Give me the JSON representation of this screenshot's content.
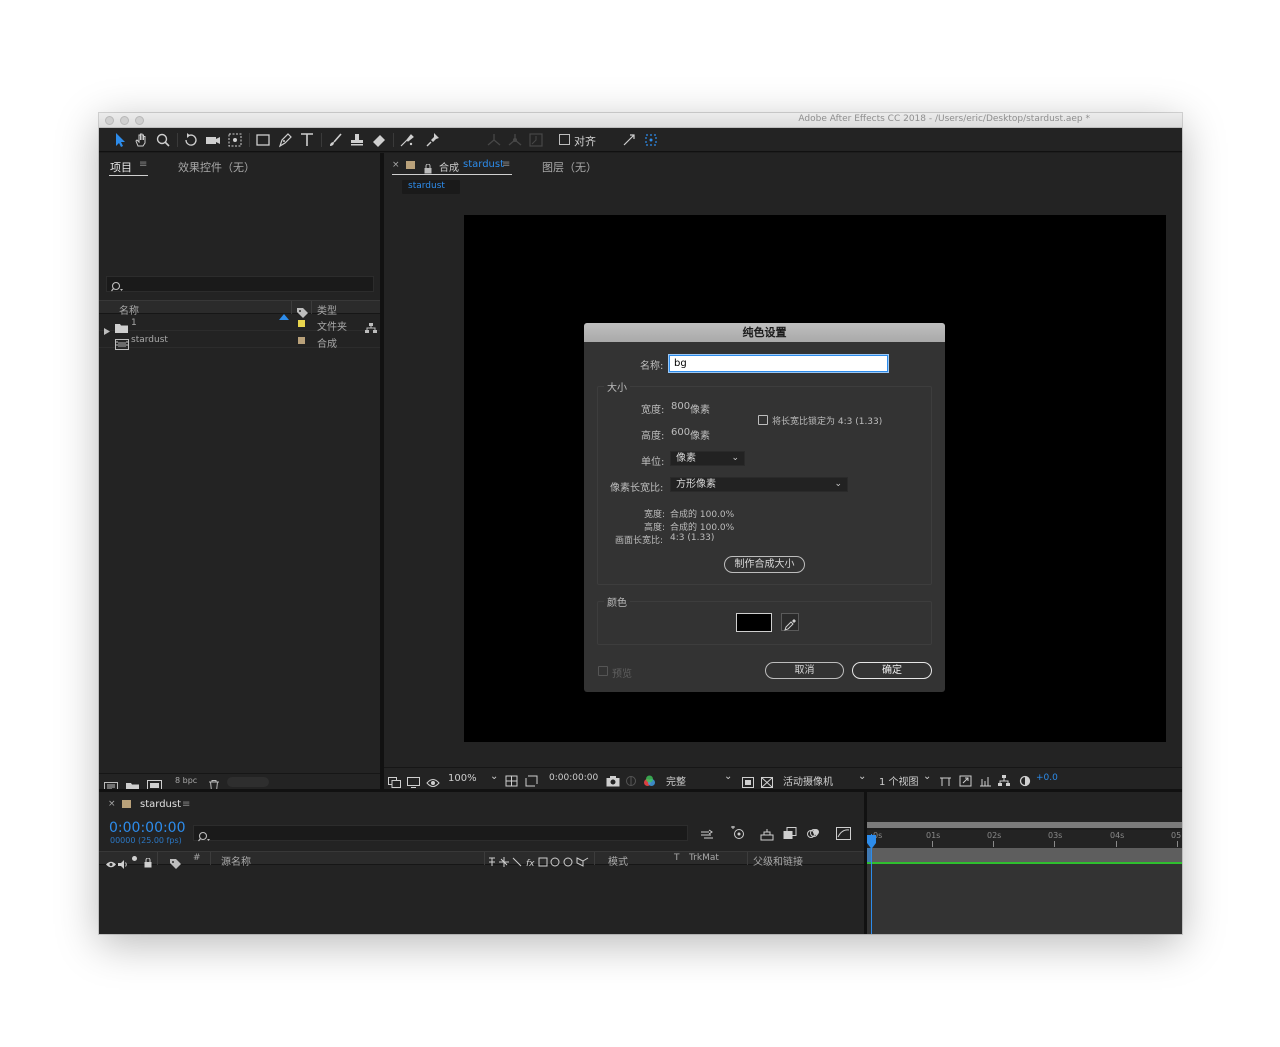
{
  "window": {
    "title": "Adobe After Effects CC 2018 - /Users/eric/Desktop/stardust.aep *"
  },
  "toolbar": {
    "snap_label": "对齐"
  },
  "project_panel": {
    "tab_project": "项目",
    "tab_effects": "效果控件（无）",
    "col_name": "名称",
    "col_type": "类型",
    "items": [
      {
        "name": "1",
        "type": "文件夹",
        "label_color": "#e8d44d",
        "icon": "folder-icon"
      },
      {
        "name": "stardust",
        "type": "合成",
        "label_color": "#b9a17a",
        "icon": "composition-icon"
      }
    ],
    "bpc_label": "8 bpc"
  },
  "comp_panel": {
    "tab_prefix": "合成",
    "tab_comp_name": "stardust",
    "tab_layer": "图层（无）",
    "subtab": "stardust"
  },
  "viewer_bar": {
    "zoom": "100%",
    "timecode": "0:00:00:00",
    "resolution": "完整",
    "camera": "活动摄像机",
    "views": "1 个视图",
    "exposure": "+0.0"
  },
  "dialog": {
    "title": "纯色设置",
    "name_label": "名称:",
    "name_value": "bg",
    "size_group": "大小",
    "width_label": "宽度:",
    "width_value": "800",
    "height_label": "高度:",
    "height_value": "600",
    "unit_pixels": "像素",
    "lock_aspect": "将长宽比锁定为 4:3 (1.33)",
    "units_label": "单位:",
    "units_value": "像素",
    "par_label": "像素长宽比:",
    "par_value": "方形像素",
    "info_width_label": "宽度:",
    "info_width_value": "合成的 100.0%",
    "info_height_label": "高度:",
    "info_height_value": "合成的 100.0%",
    "info_frame_label": "画面长宽比:",
    "info_frame_value": "4:3 (1.33)",
    "make_comp_size": "制作合成大小",
    "color_group": "颜色",
    "color_value": "#000000",
    "preview_label": "预览",
    "cancel": "取消",
    "ok": "确定"
  },
  "timeline": {
    "comp_tab": "stardust",
    "timecode": "0:00:00:00",
    "frame_info": "00000 (25.00 fps)",
    "col_hash": "#",
    "col_source": "源名称",
    "col_mode": "模式",
    "col_t": "T",
    "col_trkmat": "TrkMat",
    "col_parent": "父级和链接",
    "ruler_ticks": [
      "0s",
      "01s",
      "02s",
      "03s",
      "04s",
      "05"
    ]
  },
  "colors": {
    "accent": "#2d8ceb",
    "work_area_bar": "#2fbf2f"
  }
}
